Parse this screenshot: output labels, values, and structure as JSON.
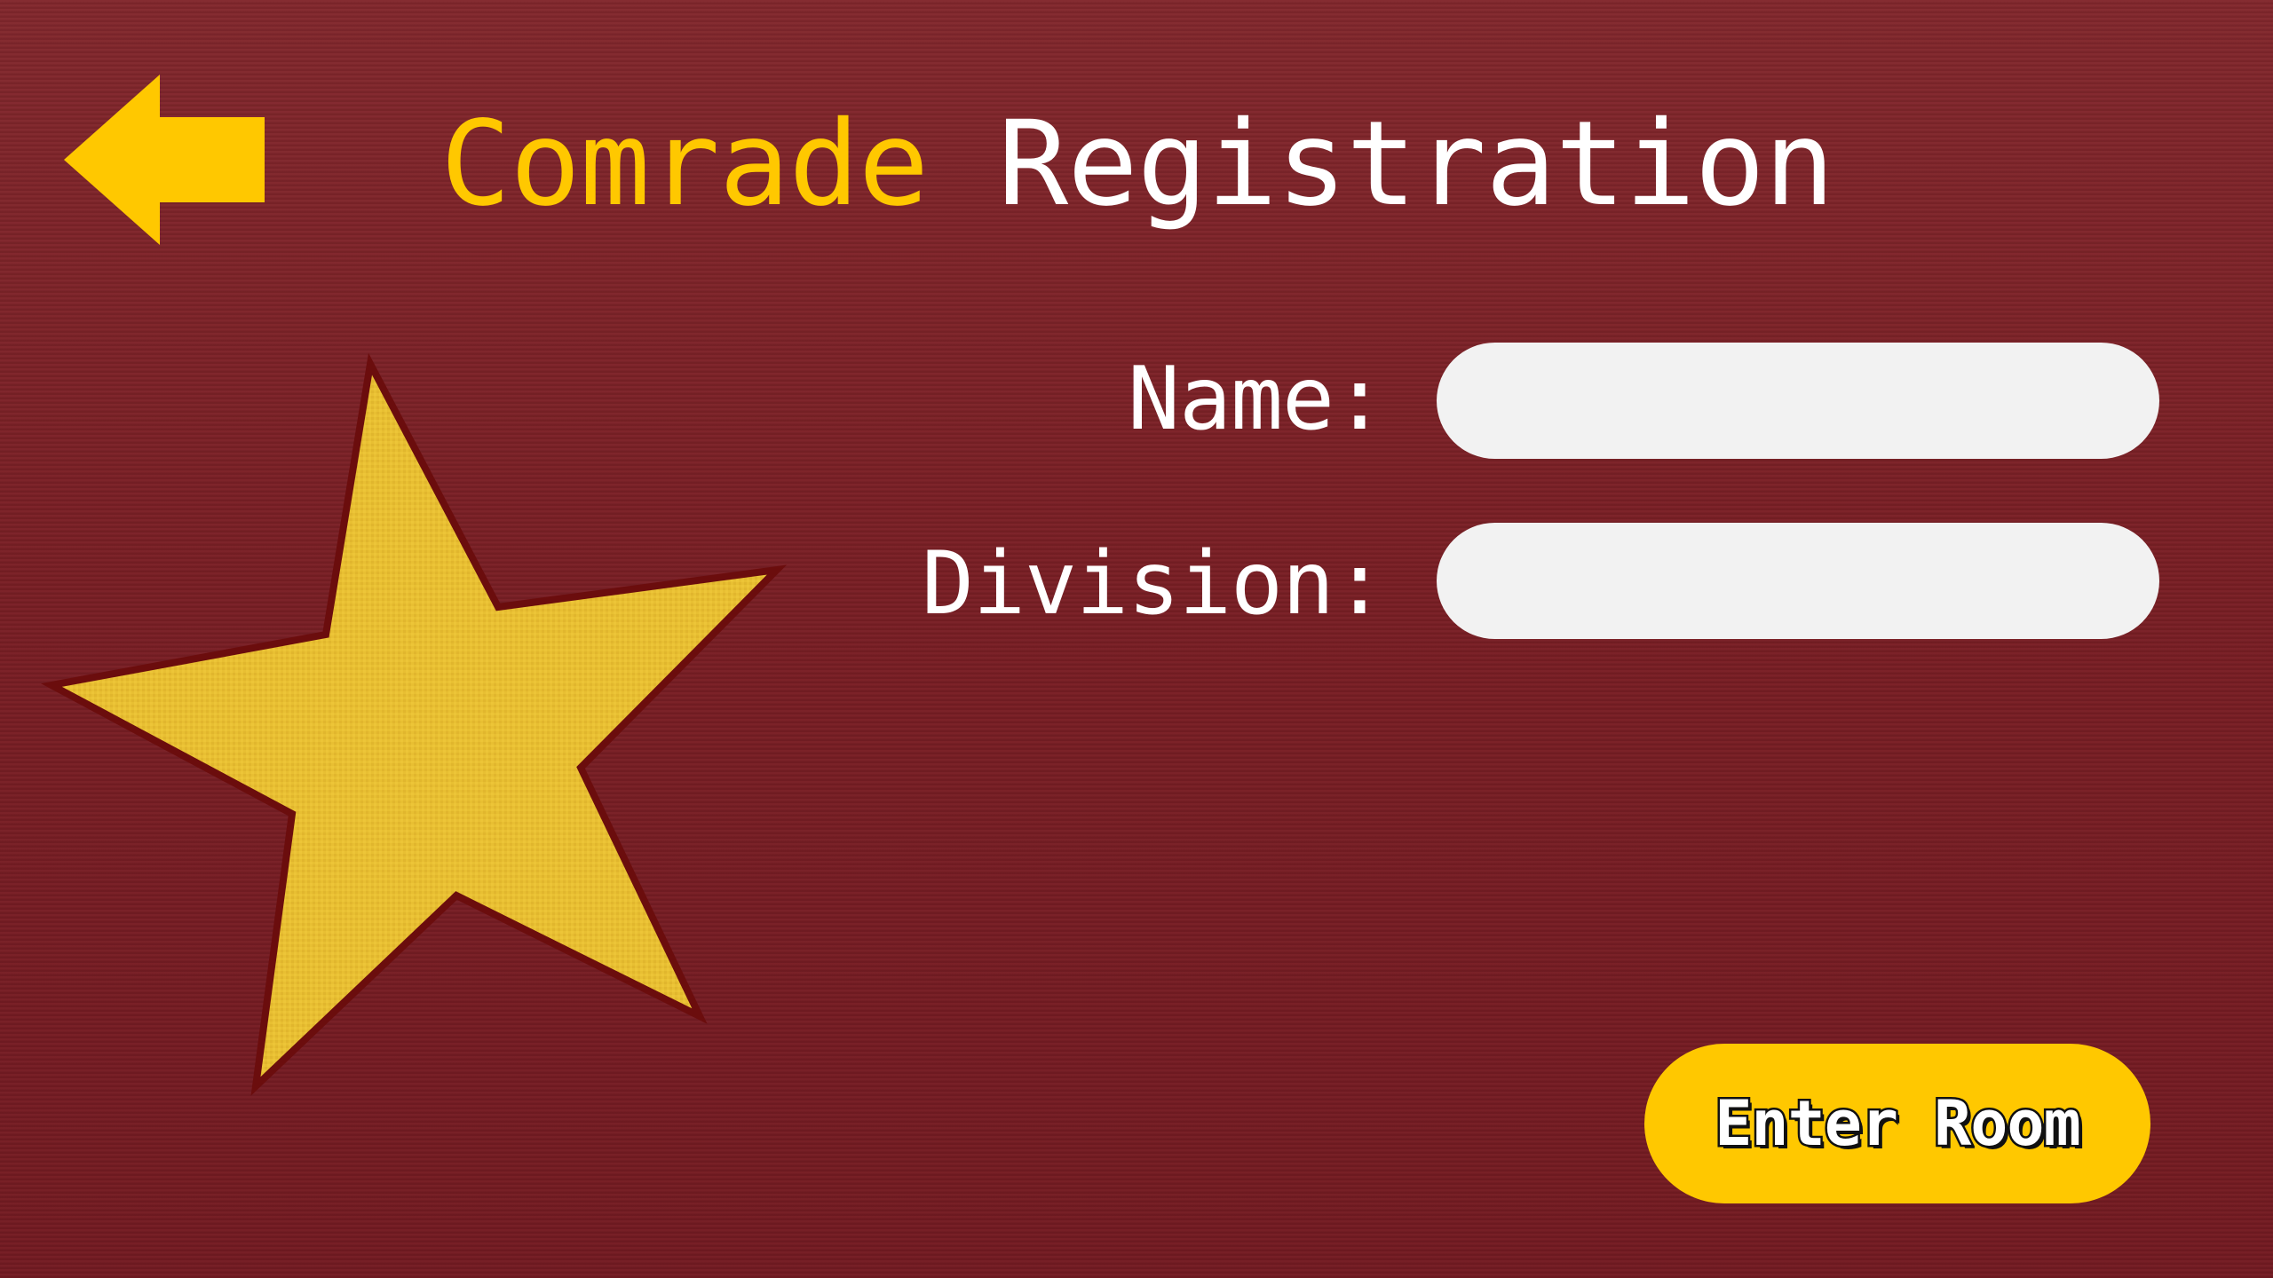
{
  "header": {
    "back_icon": "arrow-left-icon",
    "title_word_1": "Comrade",
    "title_word_2": "Registration"
  },
  "emblem": {
    "icon": "star-icon"
  },
  "form": {
    "name_label": "Name:",
    "name_value": "",
    "division_label": "Division:",
    "division_value": ""
  },
  "actions": {
    "enter_label": "Enter Room"
  },
  "colors": {
    "background": "#7c2127",
    "accent_yellow": "#ffc800",
    "star_fill": "#e8bf32",
    "star_outline": "#6b0d0d",
    "field_fill": "#f2f2f2",
    "text_white": "#ffffff"
  }
}
